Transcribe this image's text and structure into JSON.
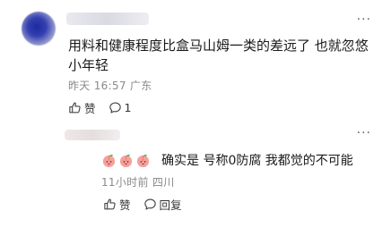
{
  "comment": {
    "text": "用料和健康程度比盒马山姆一类的差远了 也就忽悠小年轻",
    "time": "昨天 16:57",
    "location": "广东",
    "like_label": "赞",
    "reply_count": "1"
  },
  "reply": {
    "text": "确实是 号称0防腐 我都觉的不可能",
    "time": "11小时前",
    "location": "四川",
    "like_label": "赞",
    "reply_label": "回复"
  },
  "more_symbol": "···"
}
